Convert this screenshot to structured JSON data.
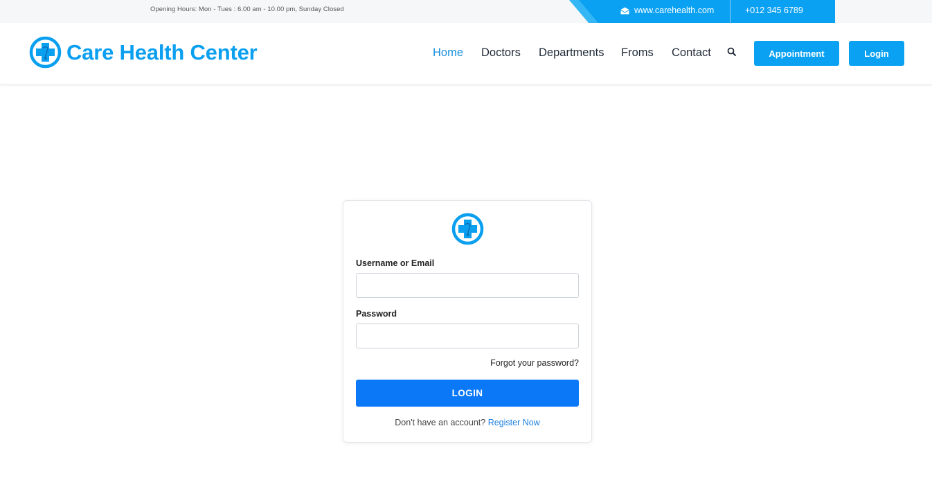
{
  "topbar": {
    "hours": "Opening Hours: Mon - Tues : 6.00 am - 10.00 pm, Sunday Closed",
    "email": "www.carehealth.com",
    "phone": "+012 345 6789"
  },
  "header": {
    "brand": "Care Health Center",
    "nav": {
      "home": "Home",
      "doctors": "Doctors",
      "departments": "Departments",
      "froms": "Froms",
      "contact": "Contact"
    },
    "appointment_label": "Appointment",
    "login_label": "Login"
  },
  "login_form": {
    "username_label": "Username or Email",
    "username_value": "",
    "password_label": "Password",
    "password_value": "",
    "forgot_label": "Forgot your password?",
    "submit_label": "LOGIN",
    "no_account_text": "Don't have an account?",
    "register_label": "Register Now"
  },
  "colors": {
    "brand_blue": "#0b9ff0",
    "login_button": "#0a78f7",
    "nav_active": "#1a8fde"
  },
  "icons": [
    "medical-cross-logo-icon",
    "envelope-icon",
    "search-icon"
  ]
}
